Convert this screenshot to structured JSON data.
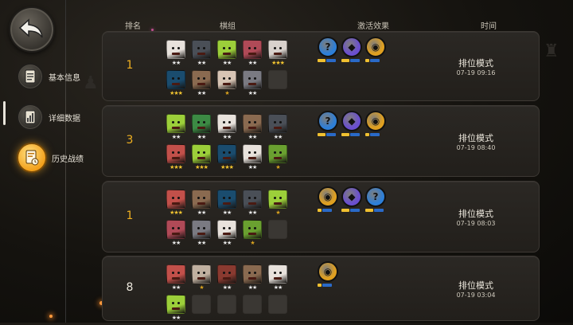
{
  "sidebar": {
    "back_icon": "back-arrow-icon",
    "items": [
      {
        "label": "基本信息",
        "icon": "profile-card-icon",
        "active": false
      },
      {
        "label": "详细数据",
        "icon": "data-report-icon",
        "active": false
      },
      {
        "label": "历史战绩",
        "icon": "history-record-icon",
        "active": true
      }
    ]
  },
  "headers": {
    "rank": "排名",
    "lineup": "棋组",
    "traits": "激活效果",
    "time": "时间"
  },
  "colors": {
    "gold_rank": "#f0b020",
    "active_tab": "#f2a01c",
    "trait_blue": "#2d7fd8",
    "trait_gold": "#e0a020",
    "trait_purple": "#6a4fd0"
  },
  "records": [
    {
      "rank": "1",
      "rank_style": "gold",
      "mode": "排位模式",
      "time": "07-19 09:16",
      "units": [
        [
          {
            "c": "#e8e2dc",
            "s": 2
          },
          {
            "c": "#4a4f57",
            "s": 2
          },
          {
            "c": "#9ccf3a",
            "s": 2
          },
          {
            "c": "#b04a57",
            "s": 2
          },
          {
            "c": "#d8d1cc",
            "s": 3
          }
        ],
        [
          {
            "c": "#1a4c6e",
            "s": 3
          },
          {
            "c": "#8a6a50",
            "s": 2
          },
          {
            "c": "#d7c4b4",
            "s": 1
          },
          {
            "c": "#7a7a82",
            "s": 2
          },
          {
            "c": null,
            "s": 0
          }
        ]
      ],
      "traits": [
        {
          "color": "#2d7fd8",
          "glyph": "?",
          "bars": [
            2,
            1
          ]
        },
        {
          "color": "#6a4fd0",
          "glyph": "◆",
          "bars": [
            2,
            1
          ]
        },
        {
          "color": "#e0a020",
          "glyph": "◉",
          "bars": [
            1,
            1
          ]
        }
      ]
    },
    {
      "rank": "3",
      "rank_style": "gold",
      "mode": "排位模式",
      "time": "07-19 08:40",
      "units": [
        [
          {
            "c": "#9ccf3a",
            "s": 2
          },
          {
            "c": "#3c8a44",
            "s": 2
          },
          {
            "c": "#e8e2dc",
            "s": 2
          },
          {
            "c": "#8a6a50",
            "s": 2
          },
          {
            "c": "#4a4f57",
            "s": 2
          }
        ],
        [
          {
            "c": "#c2504a",
            "s": 3
          },
          {
            "c": "#9ccf3a",
            "s": 3
          },
          {
            "c": "#1a4c6e",
            "s": 3
          },
          {
            "c": "#e8e2dc",
            "s": 2
          },
          {
            "c": "#6aa030",
            "s": 1
          }
        ]
      ],
      "traits": [
        {
          "color": "#2d7fd8",
          "glyph": "?",
          "bars": [
            2,
            1
          ]
        },
        {
          "color": "#6a4fd0",
          "glyph": "◆",
          "bars": [
            2,
            1
          ]
        },
        {
          "color": "#e0a020",
          "glyph": "◉",
          "bars": [
            1,
            1
          ]
        }
      ]
    },
    {
      "rank": "1",
      "rank_style": "gold",
      "mode": "排位模式",
      "time": "07-19 08:03",
      "units": [
        [
          {
            "c": "#c2504a",
            "s": 3
          },
          {
            "c": "#8a6a50",
            "s": 2
          },
          {
            "c": "#1a4c6e",
            "s": 2
          },
          {
            "c": "#4a4f57",
            "s": 2
          },
          {
            "c": "#9ccf3a",
            "s": 1
          }
        ],
        [
          {
            "c": "#b04a57",
            "s": 2
          },
          {
            "c": "#7a7a82",
            "s": 2
          },
          {
            "c": "#e8e2dc",
            "s": 2
          },
          {
            "c": "#6aa030",
            "s": 1
          },
          {
            "c": null,
            "s": 0
          }
        ]
      ],
      "traits": [
        {
          "color": "#e0a020",
          "glyph": "◉",
          "bars": [
            1,
            1
          ]
        },
        {
          "color": "#6a4fd0",
          "glyph": "◆",
          "bars": [
            2,
            1
          ]
        },
        {
          "color": "#2d7fd8",
          "glyph": "?",
          "bars": [
            2,
            1
          ]
        }
      ]
    },
    {
      "rank": "8",
      "rank_style": "white",
      "mode": "排位模式",
      "time": "07-19 03:04",
      "units": [
        [
          {
            "c": "#c2504a",
            "s": 2
          },
          {
            "c": "#c0b0a0",
            "s": 1
          },
          {
            "c": "#8a3a30",
            "s": 2
          },
          {
            "c": "#8a6a50",
            "s": 2
          },
          {
            "c": "#e8e2dc",
            "s": 2
          }
        ],
        [
          {
            "c": "#9ccf3a",
            "s": 2
          },
          {
            "c": null,
            "s": 0
          },
          {
            "c": null,
            "s": 0
          },
          {
            "c": null,
            "s": 0
          },
          {
            "c": null,
            "s": 0
          }
        ]
      ],
      "traits": [
        {
          "color": "#e0a020",
          "glyph": "◉",
          "bars": [
            1,
            1
          ]
        }
      ]
    }
  ]
}
